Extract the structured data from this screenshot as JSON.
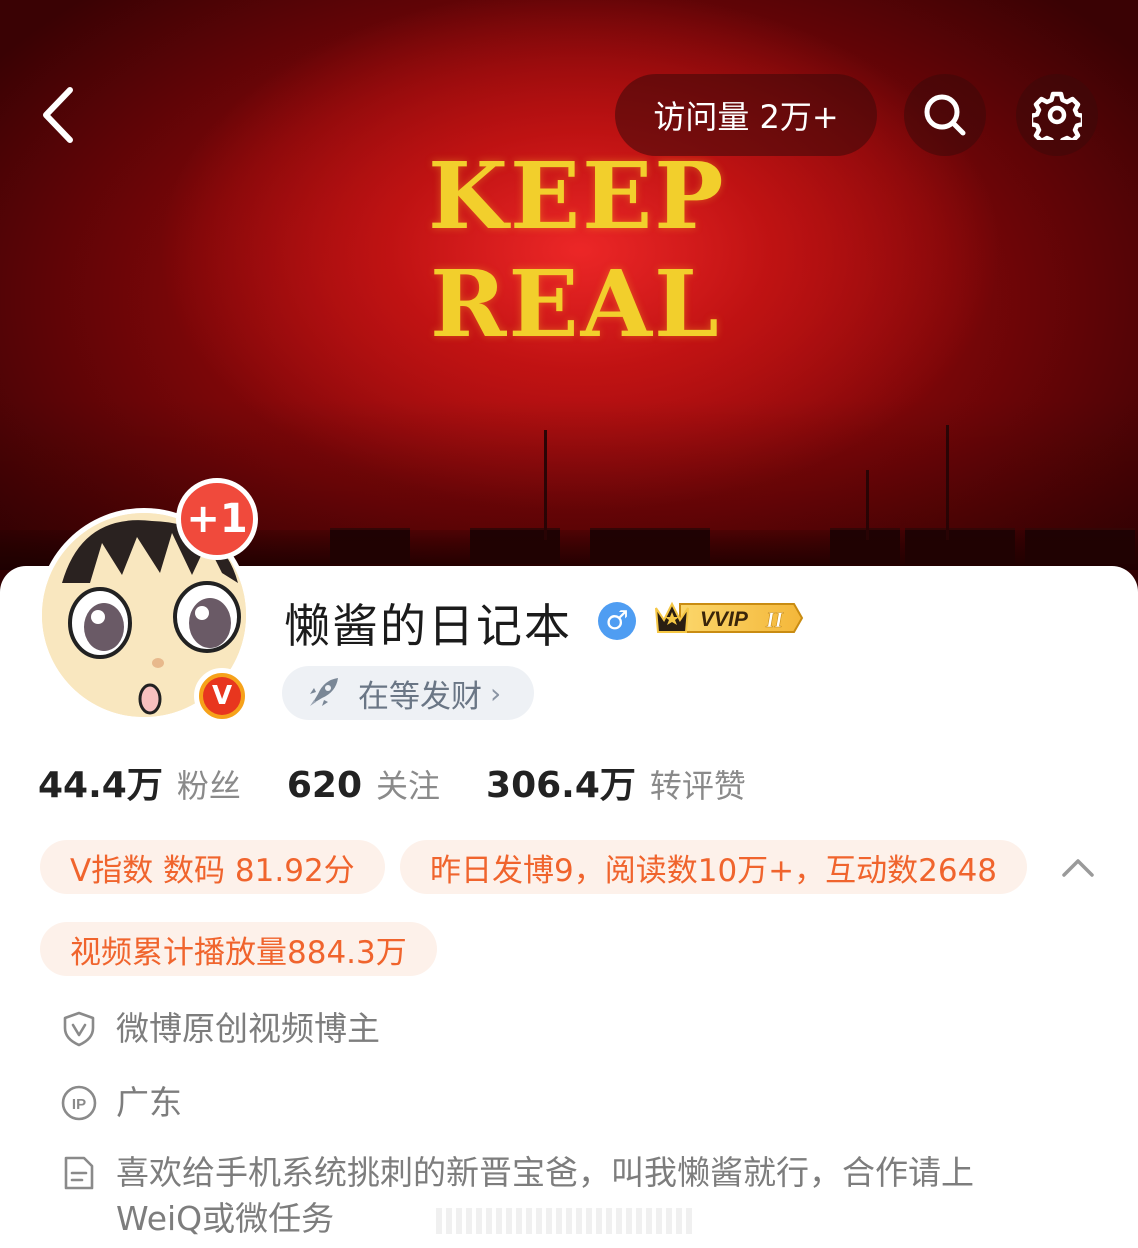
{
  "banner": {
    "line1": "KEEP",
    "line2": "REAL",
    "visit_count": "访问量 2万+"
  },
  "profile": {
    "username": "懒酱的日记本",
    "gender_symbol": "♂",
    "vip_label": "VVIP",
    "vip_level": "II",
    "notification_badge": "+1",
    "verified_badge": "V",
    "status_label": "在等发财",
    "status_chevron": "›"
  },
  "stats": [
    {
      "value": "44.4万",
      "label": "粉丝"
    },
    {
      "value": "620",
      "label": "关注"
    },
    {
      "value": "306.4万",
      "label": "转评赞"
    }
  ],
  "tags": {
    "v_index": "V指数 数码 81.92分",
    "yesterday": "昨日发博9，阅读数10万+，互动数2648",
    "video_plays": "视频累计播放量884.3万"
  },
  "info": {
    "certification": "微博原创视频博主",
    "ip_location": "广东",
    "bio": "喜欢给手机系统挑刺的新晋宝爸，叫我懒酱就行，合作请上WeiQ或微任务"
  },
  "colors": {
    "accent_orange": "#f0642d",
    "tag_bg": "#fdf1ea",
    "badge_red": "#f04a3c",
    "gender_blue": "#4f9df2",
    "banner_red": "#a80d10",
    "keep_yellow": "#f2cf2c"
  },
  "icons": [
    "back-arrow-icon",
    "search-icon",
    "gear-icon",
    "rocket-icon",
    "chevron-up-icon",
    "shield-v-icon",
    "ip-icon",
    "document-icon"
  ]
}
